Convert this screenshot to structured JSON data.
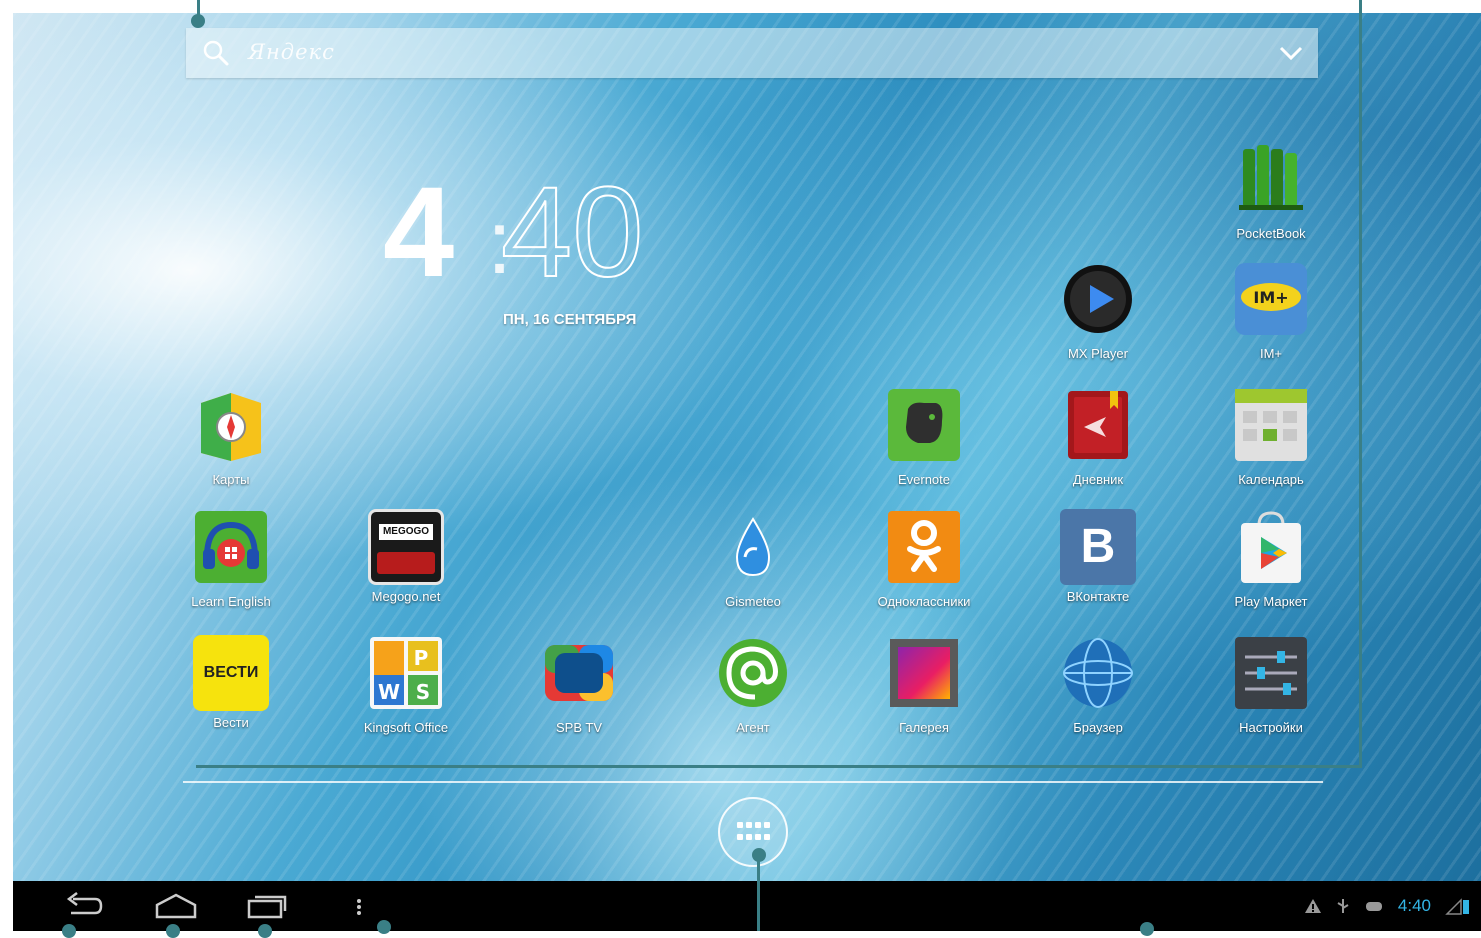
{
  "search": {
    "placeholder": "Яндекс"
  },
  "clock": {
    "hour": "4",
    "separator": ":",
    "minutes": "40",
    "date": "ПН, 16 СЕНТЯБРЯ"
  },
  "apps": {
    "pocketbook": "PocketBook",
    "mx_player": "MX Player",
    "im_plus": "IM+",
    "maps": "Карты",
    "evernote": "Evernote",
    "diary": "Дневник",
    "calendar": "Календарь",
    "learn_english": "Learn English",
    "megogo": "Megogo.net",
    "megogo_logo": "MEGOGO",
    "gismeteo": "Gismeteo",
    "odnoklassniki": "Одноклассники",
    "vkontakte": "ВКонтакте",
    "vk_letter": "B",
    "play_market": "Play Маркет",
    "vesti": "Вести",
    "vesti_logo": "ВЕСТИ",
    "kingsoft": "Kingsoft Office",
    "spbtv": "SPB TV",
    "agent": "Агент",
    "gallery": "Галерея",
    "browser": "Браузер",
    "settings": "Настройки"
  },
  "status_bar": {
    "time": "4:40"
  },
  "colors": {
    "accent": "#33b5e5",
    "callout": "#3a7f86",
    "navbar": "#000000"
  }
}
